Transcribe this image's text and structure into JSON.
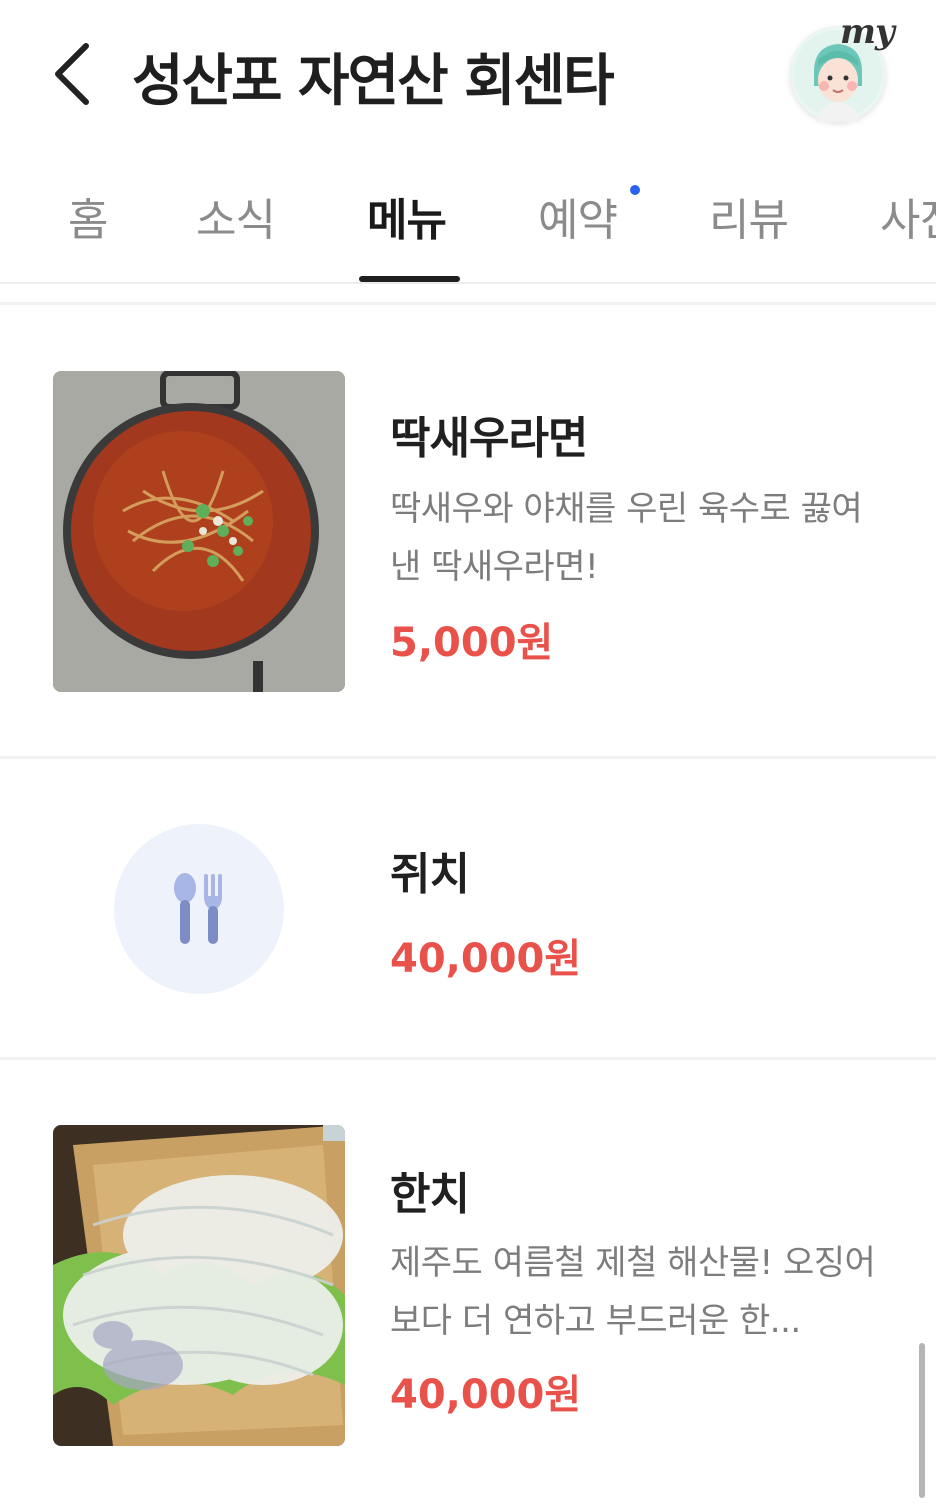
{
  "header": {
    "title": "성산포 자연산 회센타",
    "my_label": "my"
  },
  "tabs": [
    {
      "label": "홈",
      "active": false
    },
    {
      "label": "소식",
      "active": false
    },
    {
      "label": "메뉴",
      "active": true
    },
    {
      "label": "예약",
      "active": false,
      "has_dot": true
    },
    {
      "label": "리뷰",
      "active": false
    },
    {
      "label": "사진",
      "active": false
    }
  ],
  "menu_items": [
    {
      "name": "딱새우라면",
      "description": "딱새우와 야채를 우린 육수로 끓여낸 딱새우라면!",
      "price": "5,000원",
      "image": "ramen-photo"
    },
    {
      "name": "쥐치",
      "price": "40,000원",
      "image": "fork-spoon-icon"
    },
    {
      "name": "한치",
      "description": "제주도 여름철 제철 해산물! 오징어보다 더 연하고 부드러운 한...",
      "price": "40,000원",
      "image": "squid-photo"
    }
  ],
  "colors": {
    "price": "#e9524a",
    "tab_dot": "#2b63f0",
    "active_tab": "#1a1a1a",
    "inactive_tab": "#8b8b8b"
  }
}
